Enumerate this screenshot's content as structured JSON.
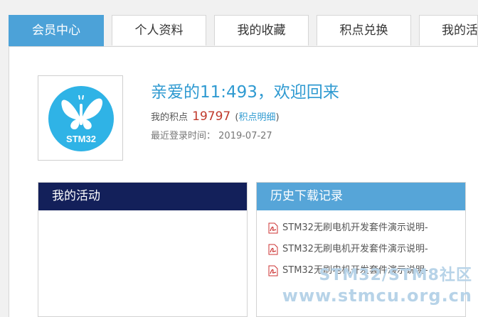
{
  "tabs": [
    {
      "label": "会员中心",
      "active": true
    },
    {
      "label": "个人资料",
      "active": false
    },
    {
      "label": "我的收藏",
      "active": false
    },
    {
      "label": "积点兑换",
      "active": false
    },
    {
      "label": "我的活动",
      "active": false
    }
  ],
  "profile": {
    "avatar_text": "STM32",
    "welcome": "亲爱的11:493，欢迎回来",
    "points_label": "我的积点",
    "points_value": "19797",
    "points_link": "积点明细",
    "last_login_label": "最近登录时间：",
    "last_login": "2019-07-27"
  },
  "activity": {
    "title": "我的活动"
  },
  "downloads": {
    "title": "历史下载记录",
    "items": [
      "STM32无刷电机开发套件演示说明-",
      "STM32无刷电机开发套件演示说明-",
      "STM32无刷电机开发套件演示说明-"
    ]
  },
  "watermark": {
    "line1": "STM32/STM8社区",
    "line2": "www.stmcu.org.cn"
  },
  "colors": {
    "accent": "#4ca2d8",
    "navy": "#13205a",
    "points": "#c0392b",
    "link": "#2f9ad1"
  }
}
